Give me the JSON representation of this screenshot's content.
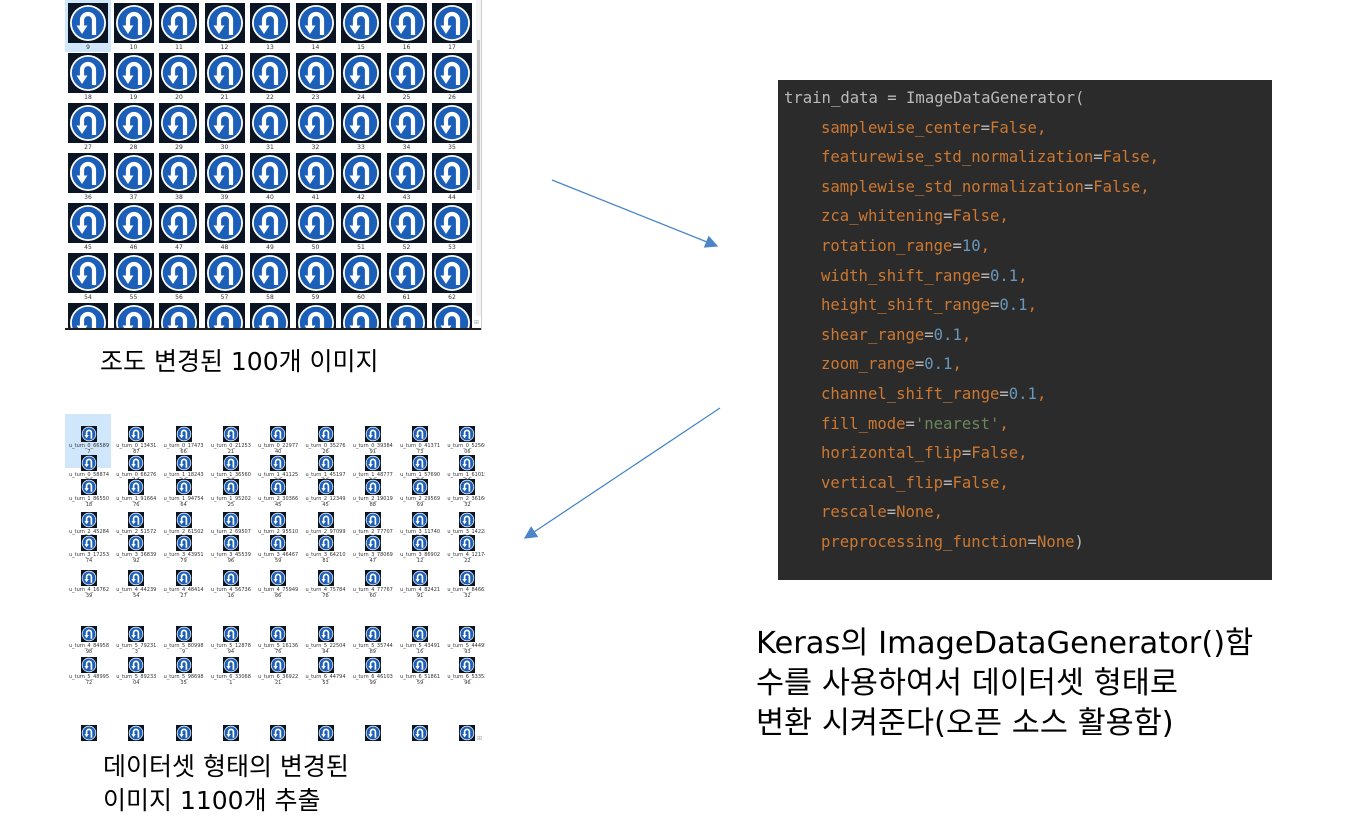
{
  "thumb_grid": {
    "numbers": [
      "9",
      "10",
      "11",
      "12",
      "13",
      "14",
      "15",
      "16",
      "17",
      "18",
      "19",
      "20",
      "21",
      "22",
      "23",
      "24",
      "25",
      "26",
      "27",
      "28",
      "29",
      "30",
      "31",
      "32",
      "33",
      "34",
      "35",
      "36",
      "37",
      "38",
      "39",
      "40",
      "41",
      "42",
      "43",
      "44",
      "45",
      "46",
      "47",
      "48",
      "49",
      "50",
      "51",
      "52",
      "53",
      "54",
      "55",
      "56",
      "57",
      "58",
      "59",
      "60",
      "61",
      "62"
    ],
    "caption": "조도 변경된 100개 이미지"
  },
  "dataset_grid": {
    "labels": [
      [
        "u_turn_0_66589",
        "7"
      ],
      [
        "u_turn_0_13431",
        "87"
      ],
      [
        "u_turn_0_17473",
        "66"
      ],
      [
        "u_turn_0_21253",
        "21"
      ],
      [
        "u_turn_0_22977",
        "40"
      ],
      [
        "u_turn_0_35276",
        "26"
      ],
      [
        "u_turn_0_39384",
        "91"
      ],
      [
        "u_turn_0_41371",
        "73"
      ],
      [
        "u_turn_0_52566",
        "06"
      ],
      [
        "u_turn_0_58874",
        "80"
      ],
      [
        "u_turn_0_66276",
        "17"
      ],
      [
        "u_turn_1_18243",
        "99"
      ],
      [
        "u_turn_1_36560",
        "27"
      ],
      [
        "u_turn_1_41125",
        "93"
      ],
      [
        "u_turn_1_45197",
        "90"
      ],
      [
        "u_turn_1_48777",
        "90"
      ],
      [
        "u_turn_1_57690",
        "80"
      ],
      [
        "u_turn_1_61015",
        "80"
      ],
      [
        "u_turn_1_86550",
        "18"
      ],
      [
        "u_turn_1_91664",
        "76"
      ],
      [
        "u_turn_1_94754",
        "64"
      ],
      [
        "u_turn_1_95202",
        "25"
      ],
      [
        "u_turn_2_30366",
        "45"
      ],
      [
        "u_turn_2_12349",
        "45"
      ],
      [
        "u_turn_2_19019",
        "88"
      ],
      [
        "u_turn_2_29569",
        "69"
      ],
      [
        "u_turn_2_36166",
        "32"
      ],
      [
        "u_turn_2_45284",
        "42"
      ],
      [
        "u_turn_2_51572",
        "82"
      ],
      [
        "u_turn_2_61502",
        "64"
      ],
      [
        "u_turn_2_69507",
        "97"
      ],
      [
        "u_turn_2_95510",
        "14"
      ],
      [
        "u_turn_2_97099",
        "04"
      ],
      [
        "u_turn_2_77707",
        "0"
      ],
      [
        "u_turn_3_11740",
        "36"
      ],
      [
        "u_turn_3_14228",
        "16"
      ],
      [
        "u_turn_3_17253",
        "74"
      ],
      [
        "u_turn_3_36839",
        "92"
      ],
      [
        "u_turn_3_43951",
        "79"
      ],
      [
        "u_turn_3_45539",
        "96"
      ],
      [
        "u_turn_3_46467",
        "59"
      ],
      [
        "u_turn_3_64210",
        "81"
      ],
      [
        "u_turn_3_78069",
        "47"
      ],
      [
        "u_turn_3_86902",
        "12"
      ],
      [
        "u_turn_4_12174",
        "22"
      ],
      [
        "u_turn_4_16762",
        "39"
      ],
      [
        "u_turn_4_44239",
        "54"
      ],
      [
        "u_turn_4_48414",
        "27"
      ],
      [
        "u_turn_4_56736",
        "16"
      ],
      [
        "u_turn_4_75949",
        "86"
      ],
      [
        "u_turn_4_75784",
        "76"
      ],
      [
        "u_turn_4_77767",
        "60"
      ],
      [
        "u_turn_4_82421",
        "91"
      ],
      [
        "u_turn_4_84662",
        "32"
      ],
      [
        "u_turn_4_84958",
        "98"
      ],
      [
        "u_turn_5_79231",
        "3"
      ],
      [
        "u_turn_5_80998",
        "9"
      ],
      [
        "u_turn_5_12878",
        "94"
      ],
      [
        "u_turn_5_16136",
        "76"
      ],
      [
        "u_turn_5_22504",
        "94"
      ],
      [
        "u_turn_5_35744",
        "89"
      ],
      [
        "u_turn_5_43491",
        "16"
      ],
      [
        "u_turn_5_44495",
        "93"
      ],
      [
        "u_turn_5_48995",
        "72"
      ],
      [
        "u_turn_5_89233",
        "04"
      ],
      [
        "u_turn_5_98698",
        "35"
      ],
      [
        "u_turn_6_33068",
        "1"
      ],
      [
        "u_turn_6_36922",
        "21"
      ],
      [
        "u_turn_6_44794",
        "53"
      ],
      [
        "u_turn_6_46103",
        "99"
      ],
      [
        "u_turn_6_51861",
        "59"
      ],
      [
        "u_turn_6_53352",
        "96"
      ]
    ],
    "caption_line1": "데이터셋 형태의 변경된",
    "caption_line2": "이미지 1100개 추출"
  },
  "code": {
    "lines": [
      [
        {
          "t": "train_data = ImageDataGenerator(",
          "c": "pn"
        }
      ],
      [
        {
          "t": "samplewise_center",
          "c": "kw"
        },
        {
          "t": "=",
          "c": "eq"
        },
        {
          "t": "False",
          "c": "kw"
        },
        {
          "t": ",",
          "c": "kw"
        }
      ],
      [
        {
          "t": "featurewise_std_normalization",
          "c": "kw"
        },
        {
          "t": "=",
          "c": "eq"
        },
        {
          "t": "False",
          "c": "kw"
        },
        {
          "t": ",",
          "c": "kw"
        }
      ],
      [
        {
          "t": "samplewise_std_normalization",
          "c": "kw"
        },
        {
          "t": "=",
          "c": "eq"
        },
        {
          "t": "False",
          "c": "kw"
        },
        {
          "t": ",",
          "c": "kw"
        }
      ],
      [
        {
          "t": "zca_whitening",
          "c": "kw"
        },
        {
          "t": "=",
          "c": "eq"
        },
        {
          "t": "False",
          "c": "kw"
        },
        {
          "t": ",",
          "c": "kw"
        }
      ],
      [
        {
          "t": "rotation_range",
          "c": "kw"
        },
        {
          "t": "=",
          "c": "eq"
        },
        {
          "t": "10",
          "c": "nm"
        },
        {
          "t": ",",
          "c": "kw"
        }
      ],
      [
        {
          "t": "width_shift_range",
          "c": "kw"
        },
        {
          "t": "=",
          "c": "eq"
        },
        {
          "t": "0.1",
          "c": "nm"
        },
        {
          "t": ",",
          "c": "kw"
        }
      ],
      [
        {
          "t": "height_shift_range",
          "c": "kw"
        },
        {
          "t": "=",
          "c": "eq"
        },
        {
          "t": "0.1",
          "c": "nm"
        },
        {
          "t": ",",
          "c": "kw"
        }
      ],
      [
        {
          "t": "shear_range",
          "c": "kw"
        },
        {
          "t": "=",
          "c": "eq"
        },
        {
          "t": "0.1",
          "c": "nm"
        },
        {
          "t": ",",
          "c": "kw"
        }
      ],
      [
        {
          "t": "zoom_range",
          "c": "kw"
        },
        {
          "t": "=",
          "c": "eq"
        },
        {
          "t": "0.1",
          "c": "nm"
        },
        {
          "t": ",",
          "c": "kw"
        }
      ],
      [
        {
          "t": "channel_shift_range",
          "c": "kw"
        },
        {
          "t": "=",
          "c": "eq"
        },
        {
          "t": "0.1",
          "c": "nm"
        },
        {
          "t": ",",
          "c": "kw"
        }
      ],
      [
        {
          "t": "fill_mode",
          "c": "kw"
        },
        {
          "t": "=",
          "c": "eq"
        },
        {
          "t": "'nearest'",
          "c": "st"
        },
        {
          "t": ",",
          "c": "kw"
        }
      ],
      [
        {
          "t": "horizontal_flip",
          "c": "kw"
        },
        {
          "t": "=",
          "c": "eq"
        },
        {
          "t": "False",
          "c": "kw"
        },
        {
          "t": ",",
          "c": "kw"
        }
      ],
      [
        {
          "t": "vertical_flip",
          "c": "kw"
        },
        {
          "t": "=",
          "c": "eq"
        },
        {
          "t": "False",
          "c": "kw"
        },
        {
          "t": ",",
          "c": "kw"
        }
      ],
      [
        {
          "t": "rescale",
          "c": "kw"
        },
        {
          "t": "=",
          "c": "eq"
        },
        {
          "t": "None",
          "c": "kw"
        },
        {
          "t": ",",
          "c": "kw"
        }
      ],
      [
        {
          "t": "preprocessing_function",
          "c": "kw"
        },
        {
          "t": "=",
          "c": "eq"
        },
        {
          "t": "None",
          "c": "kw"
        },
        {
          "t": ")",
          "c": "pn"
        }
      ]
    ]
  },
  "description": {
    "line1": "Keras의 ImageDataGenerator()함",
    "line2": "수를 사용하여서 데이터셋 형태로",
    "line3": "변환 시켜준다(오픈 소스 활용함)"
  },
  "colors": {
    "code_bg": "#2b2b2b",
    "keyword": "#cc7832",
    "number": "#6897bb",
    "string": "#6a8759",
    "plain": "#bababa",
    "sign_blue": "#1c5fb8",
    "arrow": "#4a86c8"
  },
  "icons": {
    "sign": "u-turn-sign-icon"
  }
}
